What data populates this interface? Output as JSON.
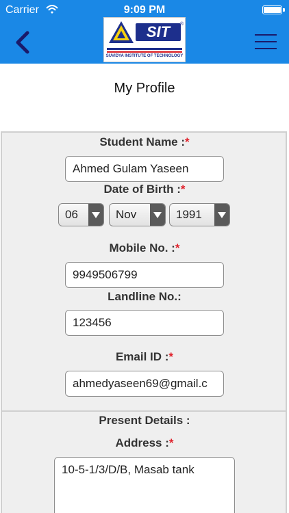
{
  "status_bar": {
    "carrier": "Carrier",
    "time": "9:09 PM",
    "battery_level": 1.0
  },
  "nav": {
    "logo_text": "SIT",
    "logo_tagline": "SUVIDYA INSTITUTE OF TECHNOLOGY",
    "logo_reg": "®"
  },
  "page": {
    "title": "My Profile"
  },
  "form": {
    "student_name": {
      "label": "Student Name :",
      "required_mark": "*",
      "value": "Ahmed Gulam Yaseen"
    },
    "dob": {
      "label": "Date of Birth :",
      "required_mark": "*",
      "day": "06",
      "month": "Nov",
      "year": "1991"
    },
    "mobile": {
      "label": "Mobile No. :",
      "required_mark": "*",
      "value": "9949506799"
    },
    "landline": {
      "label": "Landline No.:",
      "value": "123456"
    },
    "email": {
      "label": "Email ID :",
      "required_mark": "*",
      "value": "ahmedyaseen69@gmail.c"
    },
    "present_details": {
      "label": "Present Details :"
    },
    "address": {
      "label": "Address :",
      "required_mark": "*",
      "value": "10-5-1/3/D/B, Masab tank"
    }
  },
  "colors": {
    "header_blue": "#1a88e6",
    "required_red": "#e0202a",
    "logo_navy": "#1d2f8c"
  }
}
